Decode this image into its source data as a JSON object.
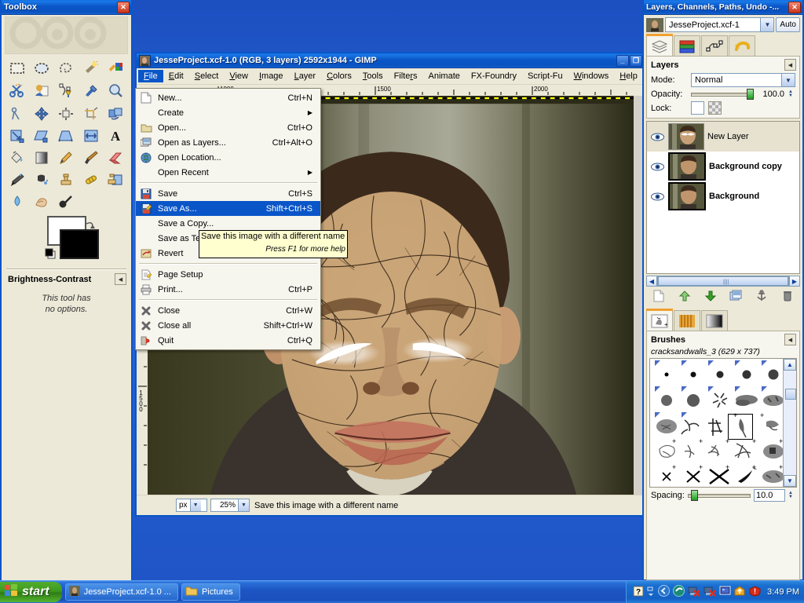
{
  "toolbox": {
    "title": "Toolbox",
    "close_label": "✕",
    "tools": [
      {
        "name": "rect-select-tool",
        "label": "Rectangle Select"
      },
      {
        "name": "ellipse-select-tool",
        "label": "Ellipse Select"
      },
      {
        "name": "free-select-tool",
        "label": "Free Select"
      },
      {
        "name": "fuzzy-select-tool",
        "label": "Fuzzy Select"
      },
      {
        "name": "select-by-color-tool",
        "label": "Select by Color"
      },
      {
        "name": "scissors-select-tool",
        "label": "Scissors Select"
      },
      {
        "name": "foreground-select-tool",
        "label": "Foreground Select"
      },
      {
        "name": "paths-tool",
        "label": "Paths"
      },
      {
        "name": "color-picker-tool",
        "label": "Color Picker"
      },
      {
        "name": "zoom-tool",
        "label": "Zoom"
      },
      {
        "name": "measure-tool",
        "label": "Measure"
      },
      {
        "name": "move-tool",
        "label": "Move"
      },
      {
        "name": "align-tool",
        "label": "Alignment"
      },
      {
        "name": "crop-tool",
        "label": "Crop"
      },
      {
        "name": "rotate-tool",
        "label": "Rotate"
      },
      {
        "name": "scale-tool",
        "label": "Scale"
      },
      {
        "name": "shear-tool",
        "label": "Shear"
      },
      {
        "name": "perspective-tool",
        "label": "Perspective"
      },
      {
        "name": "flip-tool",
        "label": "Flip"
      },
      {
        "name": "text-tool",
        "label": "Text"
      },
      {
        "name": "bucket-fill-tool",
        "label": "Bucket Fill"
      },
      {
        "name": "gradient-tool",
        "label": "Blend"
      },
      {
        "name": "pencil-tool",
        "label": "Pencil"
      },
      {
        "name": "paintbrush-tool",
        "label": "Paintbrush"
      },
      {
        "name": "eraser-tool",
        "label": "Eraser"
      },
      {
        "name": "airbrush-tool",
        "label": "Airbrush"
      },
      {
        "name": "ink-tool",
        "label": "Ink"
      },
      {
        "name": "clone-tool",
        "label": "Clone"
      },
      {
        "name": "heal-tool",
        "label": "Heal"
      },
      {
        "name": "perspective-clone-tool",
        "label": "Perspective Clone"
      },
      {
        "name": "blur-sharpen-tool",
        "label": "Blur / Sharpen"
      },
      {
        "name": "smudge-tool",
        "label": "Smudge"
      },
      {
        "name": "dodge-burn-tool",
        "label": "Dodge / Burn"
      }
    ],
    "tool_options": {
      "title": "Brightness-Contrast",
      "no_options_line1": "This tool has",
      "no_options_line2": "no options."
    }
  },
  "image_window": {
    "title": "JesseProject.xcf-1.0 (RGB, 3 layers) 2592x1944 - GIMP",
    "minimize_label": "_",
    "maximize_label": "❐",
    "menus": [
      {
        "label": "File",
        "mnemonic": "F",
        "open": true
      },
      {
        "label": "Edit",
        "mnemonic": "E",
        "open": false
      },
      {
        "label": "Select",
        "mnemonic": "S",
        "open": false
      },
      {
        "label": "View",
        "mnemonic": "V",
        "open": false
      },
      {
        "label": "Image",
        "mnemonic": "I",
        "open": false
      },
      {
        "label": "Layer",
        "mnemonic": "L",
        "open": false
      },
      {
        "label": "Colors",
        "mnemonic": "C",
        "open": false
      },
      {
        "label": "Tools",
        "mnemonic": "T",
        "open": false
      },
      {
        "label": "Filters",
        "mnemonic": "r",
        "open": false
      },
      {
        "label": "Animate",
        "mnemonic": "",
        "open": false
      },
      {
        "label": "FX-Foundry",
        "mnemonic": "",
        "open": false
      },
      {
        "label": "Script-Fu",
        "mnemonic": "",
        "open": false
      },
      {
        "label": "Windows",
        "mnemonic": "W",
        "open": false
      },
      {
        "label": "Help",
        "mnemonic": "H",
        "open": false
      }
    ],
    "ruler_h_labels": [
      "1000",
      "1500",
      "2000"
    ],
    "ruler_v_label": "1500",
    "statusbar": {
      "unit": "px",
      "zoom": "25%",
      "message": "Save this image with a different name"
    }
  },
  "file_menu": {
    "items": [
      {
        "label": "New...",
        "accel": "Ctrl+N",
        "icon": "new-file-icon",
        "type": "item",
        "selected": false
      },
      {
        "label": "Create",
        "accel": "",
        "icon": "",
        "type": "submenu",
        "selected": false
      },
      {
        "label": "Open...",
        "accel": "Ctrl+O",
        "icon": "folder-open-icon",
        "type": "item",
        "selected": false
      },
      {
        "label": "Open as Layers...",
        "accel": "Ctrl+Alt+O",
        "icon": "open-as-layers-icon",
        "type": "item",
        "selected": false
      },
      {
        "label": "Open Location...",
        "accel": "",
        "icon": "globe-icon",
        "type": "item",
        "selected": false
      },
      {
        "label": "Open Recent",
        "accel": "",
        "icon": "",
        "type": "submenu",
        "selected": false
      },
      {
        "label": "",
        "accel": "",
        "icon": "",
        "type": "separator",
        "selected": false
      },
      {
        "label": "Save",
        "accel": "Ctrl+S",
        "icon": "save-icon",
        "type": "item",
        "selected": false
      },
      {
        "label": "Save As...",
        "accel": "Shift+Ctrl+S",
        "icon": "save-as-icon",
        "type": "item",
        "selected": true
      },
      {
        "label": "Save a Copy...",
        "accel": "",
        "icon": "",
        "type": "item",
        "selected": false
      },
      {
        "label": "Save as Template...",
        "accel": "",
        "icon": "",
        "type": "item",
        "selected": false
      },
      {
        "label": "Revert",
        "accel": "",
        "icon": "revert-icon",
        "type": "item",
        "selected": false
      },
      {
        "label": "",
        "accel": "",
        "icon": "",
        "type": "separator",
        "selected": false
      },
      {
        "label": "Page Setup",
        "accel": "",
        "icon": "page-setup-icon",
        "type": "item",
        "selected": false
      },
      {
        "label": "Print...",
        "accel": "Ctrl+P",
        "icon": "printer-icon",
        "type": "item",
        "selected": false
      },
      {
        "label": "",
        "accel": "",
        "icon": "",
        "type": "separator",
        "selected": false
      },
      {
        "label": "Close",
        "accel": "Ctrl+W",
        "icon": "close-x-icon",
        "type": "item",
        "selected": false
      },
      {
        "label": "Close all",
        "accel": "Shift+Ctrl+W",
        "icon": "close-x-icon",
        "type": "item",
        "selected": false
      },
      {
        "label": "Quit",
        "accel": "Ctrl+Q",
        "icon": "quit-icon",
        "type": "item",
        "selected": false
      }
    ]
  },
  "tooltip": {
    "text": "Save this image with a different name",
    "hint": "Press F1 for more help"
  },
  "dock": {
    "title": "Layers, Channels, Paths, Undo -...",
    "close_label": "✕",
    "image_name": "JesseProject.xcf-1",
    "auto_label": "Auto",
    "tabs": [
      {
        "name": "tab-layers",
        "label": "Layers",
        "active": true
      },
      {
        "name": "tab-channels",
        "label": "Channels",
        "active": false
      },
      {
        "name": "tab-paths",
        "label": "Paths",
        "active": false
      },
      {
        "name": "tab-undo",
        "label": "Undo History",
        "active": false
      }
    ],
    "layers_panel": {
      "title": "Layers",
      "mode_label": "Mode:",
      "mode_value": "Normal",
      "opacity_label": "Opacity:",
      "opacity_value": "100.0",
      "lock_label": "Lock:",
      "layers": [
        {
          "name": "New Layer",
          "visible": true,
          "active": true,
          "bold": false
        },
        {
          "name": "Background copy",
          "visible": true,
          "active": false,
          "bold": true
        },
        {
          "name": "Background",
          "visible": true,
          "active": false,
          "bold": true
        }
      ],
      "buttons": [
        {
          "name": "new-layer-button",
          "label": "New Layer"
        },
        {
          "name": "raise-layer-button",
          "label": "Raise Layer"
        },
        {
          "name": "lower-layer-button",
          "label": "Lower Layer"
        },
        {
          "name": "duplicate-layer-button",
          "label": "Duplicate Layer"
        },
        {
          "name": "anchor-layer-button",
          "label": "Anchor Layer"
        },
        {
          "name": "delete-layer-button",
          "label": "Delete Layer"
        }
      ]
    },
    "brush_tabs": [
      {
        "name": "tab-brushes",
        "label": "Brushes",
        "active": true
      },
      {
        "name": "tab-patterns",
        "label": "Patterns",
        "active": false
      },
      {
        "name": "tab-gradients",
        "label": "Gradients",
        "active": false
      }
    ],
    "brushes_panel": {
      "title": "Brushes",
      "selected_brush": "cracksandwalls_3 (629 x 737)",
      "spacing_label": "Spacing:",
      "spacing_value": "10.0"
    }
  },
  "taskbar": {
    "start_label": "start",
    "buttons": [
      {
        "name": "taskbar-button-gimp",
        "label": "JesseProject.xcf-1.0 ...",
        "icon": "gimp-image-icon"
      },
      {
        "name": "taskbar-button-pictures",
        "label": "Pictures",
        "icon": "folder-icon"
      }
    ],
    "tray_icons": [
      {
        "name": "help-tray-icon",
        "glyph": "?"
      },
      {
        "name": "expand-tray-icon",
        "glyph": "⌃"
      },
      {
        "name": "back-tray-icon",
        "glyph": "‹"
      },
      {
        "name": "media-tray-icon",
        "glyph": "◉"
      },
      {
        "name": "network-disconnected-1-icon",
        "glyph": "✖"
      },
      {
        "name": "network-disconnected-2-icon",
        "glyph": "✖"
      },
      {
        "name": "display-tray-icon",
        "glyph": "▤"
      },
      {
        "name": "update-tray-icon",
        "glyph": "↑"
      },
      {
        "name": "security-alert-icon",
        "glyph": "!"
      }
    ],
    "clock": "3:49 PM"
  },
  "colors": {
    "title_blue": "#0a56c8",
    "selection_blue": "#0a56c8",
    "panel_bg": "#ece9d8",
    "tooltip_bg": "#ffffd0",
    "accent_orange": "#f0a030"
  }
}
